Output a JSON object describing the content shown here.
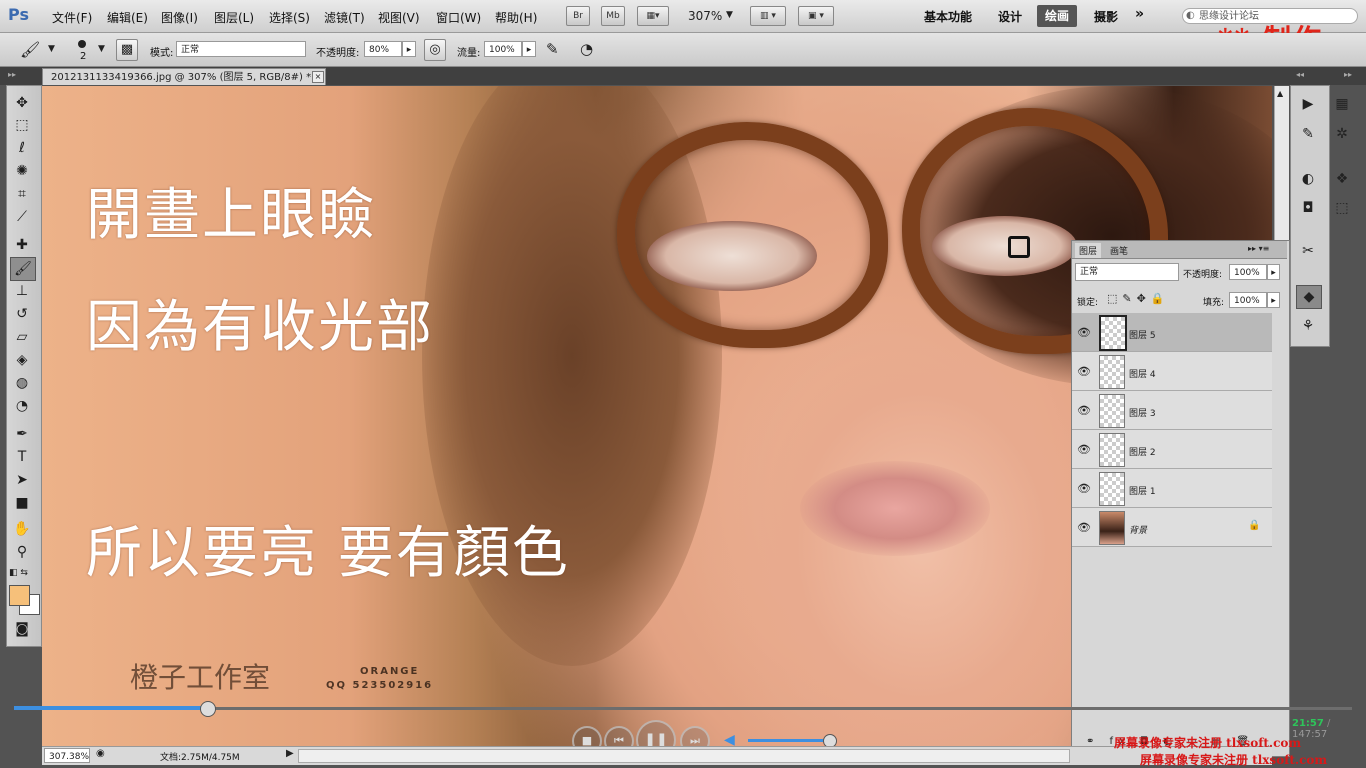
{
  "app": {
    "logo": "Ps"
  },
  "menu": [
    "文件(F)",
    "编辑(E)",
    "图像(I)",
    "图层(L)",
    "选择(S)",
    "滤镜(T)",
    "视图(V)",
    "窗口(W)",
    "帮助(H)"
  ],
  "menubar_buttons": {
    "bridge": "Br",
    "mini_bridge": "Mb",
    "zoom": "307%"
  },
  "workspaces": {
    "essentials": "基本功能",
    "design": "设计",
    "painting": "绘画",
    "photography": "摄影",
    "more": "»"
  },
  "search": {
    "placeholder": "思缘设计论坛"
  },
  "top_watermark": "** 制作",
  "options": {
    "brush_size": "2",
    "mode_label": "模式:",
    "mode_value": "正常",
    "opacity_label": "不透明度:",
    "opacity_value": "80%",
    "flow_label": "流量:",
    "flow_value": "100%"
  },
  "document": {
    "tab_title": "20121311334193​66.jpg @ 307% (图层 5, RGB/8#) *",
    "close": "×"
  },
  "captions": {
    "line1": "開畫上眼瞼",
    "line2": "因為有收光部",
    "line3": "所以要亮  要有顏色"
  },
  "studio_logo": {
    "cn": "橙子工作室",
    "en": "ORANGE",
    "qq": "QQ 523502916"
  },
  "layers_panel": {
    "tab_layers": "图层",
    "tab_paths": "画笔",
    "blend_mode": "正常",
    "opacity_label": "不透明度:",
    "opacity_value": "100%",
    "lock_label": "锁定:",
    "fill_label": "填充:",
    "fill_value": "100%",
    "layers": [
      {
        "name": "图层 5",
        "selected": true
      },
      {
        "name": "图层 4",
        "selected": false
      },
      {
        "name": "图层 3",
        "selected": false
      },
      {
        "name": "图层 2",
        "selected": false
      },
      {
        "name": "图层 1",
        "selected": false
      },
      {
        "name": "背景",
        "selected": false
      }
    ]
  },
  "status": {
    "zoom": "307.38%",
    "doc_label": "文档:2.75M/4.75M"
  },
  "player": {
    "progress": 0.144,
    "volume": 0.92,
    "elapsed": "21:57",
    "total": "147:57"
  },
  "bottom_watermark": {
    "line1": "屏幕录像专家未注册 tlxsoft.com",
    "line2": "屏幕录像专家未注册 tlxsoft.com"
  }
}
